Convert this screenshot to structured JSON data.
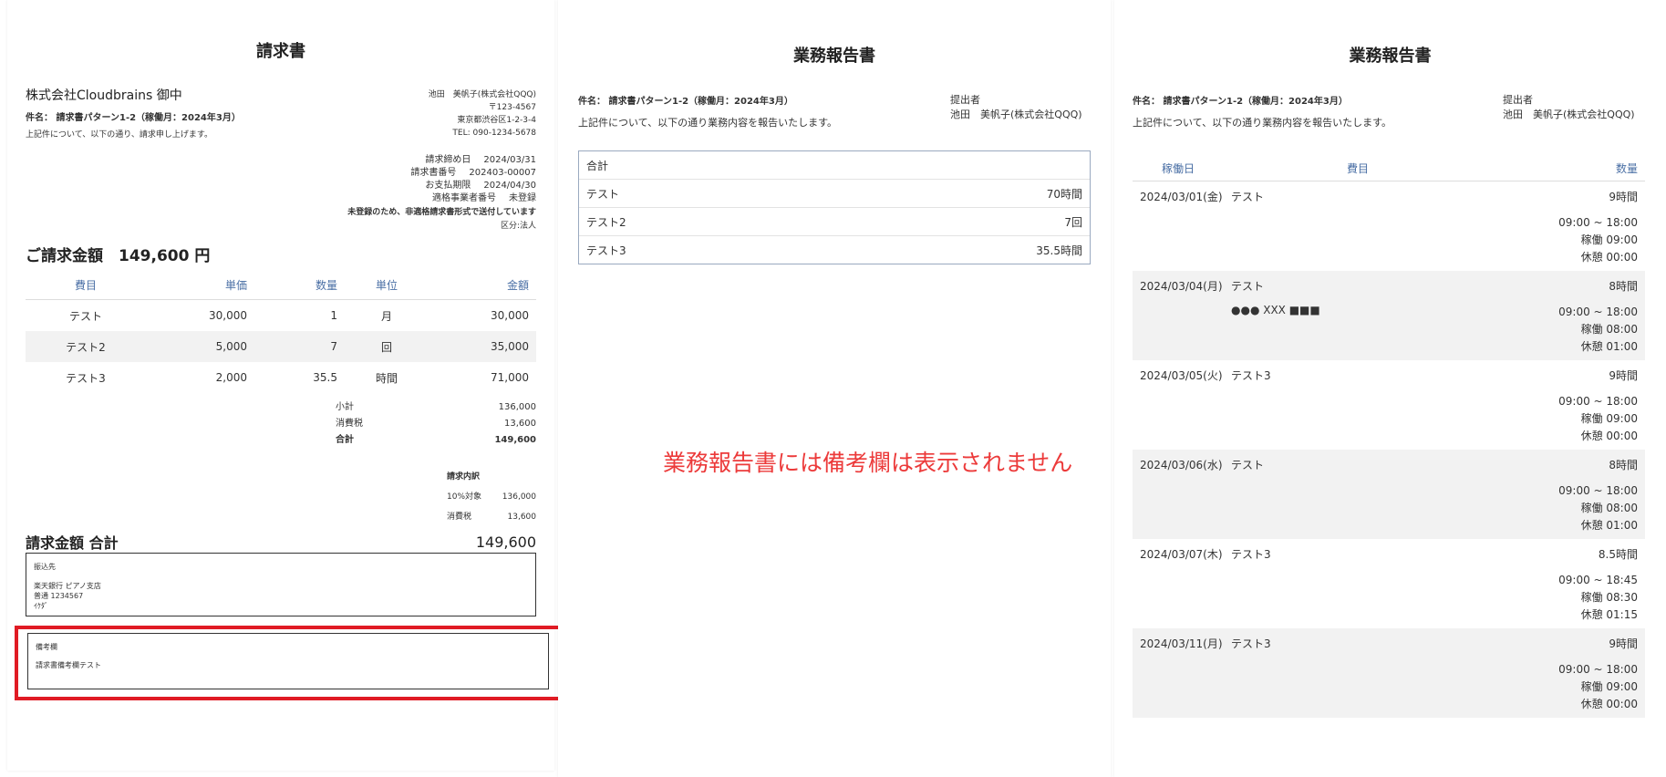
{
  "invoice": {
    "title": "請求書",
    "client": "株式会社Cloudbrains 御中",
    "subject": "件名： 請求書パターン1-2（稼働月：2024年3月）",
    "intro": "上記件について、以下の通り、請求申し上げます。",
    "issuer_name": "池田　美帆子(株式会社QQQ)",
    "issuer_zip": "〒123-4567",
    "issuer_address": "東京都渋谷区1-2-3-4",
    "issuer_tel": "TEL: 090-1234-5678",
    "meta": [
      {
        "label": "請求締め日",
        "value": "2024/03/31"
      },
      {
        "label": "請求書番号",
        "value": "202403-00007"
      },
      {
        "label": "お支払期限",
        "value": "2024/04/30"
      },
      {
        "label": "適格事業者番号",
        "value": "未登録"
      }
    ],
    "notice": "未登録のため、非適格請求書形式で送付しています",
    "category": "区分:法人",
    "amount_label": "ご請求金額　149,600 円",
    "table_headers": [
      "費目",
      "単価",
      "数量",
      "単位",
      "金額"
    ],
    "rows": [
      {
        "item": "テスト",
        "unit_price": "30,000",
        "qty": "1",
        "unit": "月",
        "amount": "30,000"
      },
      {
        "item": "テスト2",
        "unit_price": "5,000",
        "qty": "7",
        "unit": "回",
        "amount": "35,000"
      },
      {
        "item": "テスト3",
        "unit_price": "2,000",
        "qty": "35.5",
        "unit": "時間",
        "amount": "71,000"
      }
    ],
    "subtotal_label": "小計",
    "subtotal": "136,000",
    "tax_label": "消費税",
    "tax": "13,600",
    "total_label": "合計",
    "total": "149,600",
    "breakdown_title": "請求内訳",
    "breakdown_10_label": "10%対象",
    "breakdown_10": "136,000",
    "breakdown_tax_label": "消費税",
    "breakdown_tax": "13,600",
    "grand_label": "請求金額 合計",
    "grand_value": "149,600",
    "bank_title": "振込先",
    "bank_line1": "楽天銀行 ピアノ支店",
    "bank_line2": "普通 1234567",
    "bank_line3": "ｲｹﾀﾞ",
    "remarks_title": "備考欄",
    "remarks_text": "請求書備考欄テスト"
  },
  "report1": {
    "title": "業務報告書",
    "subject": "件名： 請求書パターン1-2（稼働月：2024年3月）",
    "intro": "上記件について、以下の通り業務内容を報告いたします。",
    "submitter_label": "提出者",
    "submitter": "池田　美帆子(株式会社QQQ)",
    "summary_title": "合計",
    "summary": [
      {
        "item": "テスト",
        "value": "70時間"
      },
      {
        "item": "テスト2",
        "value": "7回"
      },
      {
        "item": "テスト3",
        "value": "35.5時間"
      }
    ],
    "notice": "業務報告書には備考欄は表示されません"
  },
  "report2": {
    "title": "業務報告書",
    "subject": "件名： 請求書パターン1-2（稼働月：2024年3月）",
    "intro": "上記件について、以下の通り業務内容を報告いたします。",
    "submitter_label": "提出者",
    "submitter": "池田　美帆子(株式会社QQQ)",
    "headers": {
      "date": "稼働日",
      "item": "費目",
      "qty": "数量"
    },
    "days": [
      {
        "date": "2024/03/01(金)",
        "item": "テスト",
        "hours": "9時間",
        "memo": "",
        "time": "09:00 ~ 18:00",
        "work": "稼働 09:00",
        "rest": "休憩 00:00"
      },
      {
        "date": "2024/03/04(月)",
        "item": "テスト",
        "hours": "8時間",
        "memo": "●●● XXX ■■■",
        "time": "09:00 ~ 18:00",
        "work": "稼働 08:00",
        "rest": "休憩 01:00"
      },
      {
        "date": "2024/03/05(火)",
        "item": "テスト3",
        "hours": "9時間",
        "memo": "",
        "time": "09:00 ~ 18:00",
        "work": "稼働 09:00",
        "rest": "休憩 00:00"
      },
      {
        "date": "2024/03/06(水)",
        "item": "テスト",
        "hours": "8時間",
        "memo": "",
        "time": "09:00 ~ 18:00",
        "work": "稼働 08:00",
        "rest": "休憩 01:00"
      },
      {
        "date": "2024/03/07(木)",
        "item": "テスト3",
        "hours": "8.5時間",
        "memo": "",
        "time": "09:00 ~ 18:45",
        "work": "稼働 08:30",
        "rest": "休憩 01:15"
      },
      {
        "date": "2024/03/11(月)",
        "item": "テスト3",
        "hours": "9時間",
        "memo": "",
        "time": "09:00 ~ 18:00",
        "work": "稼働 09:00",
        "rest": "休憩 00:00"
      }
    ]
  }
}
